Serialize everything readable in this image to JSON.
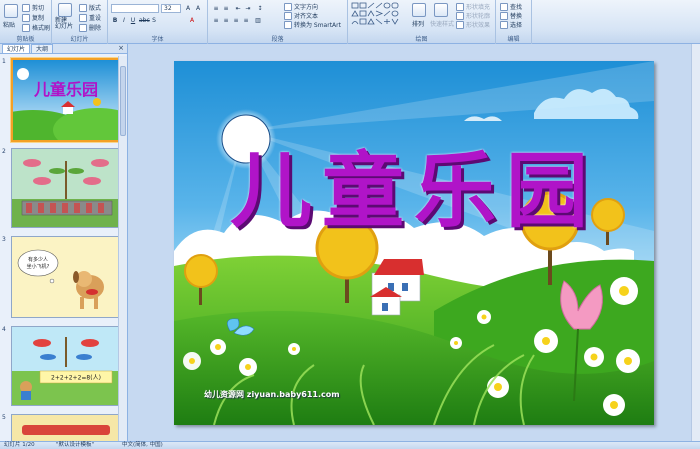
{
  "ribbon": {
    "clipboard": {
      "label": "剪贴板",
      "paste": "粘贴",
      "cut": "剪切",
      "copy": "复制",
      "format_painter": "格式刷"
    },
    "slides": {
      "label": "幻灯片",
      "new_slide": "新建\n幻灯片",
      "layout": "版式",
      "reset": "重设",
      "delete": "删除"
    },
    "font": {
      "label": "字体",
      "font_size": "32"
    },
    "paragraph": {
      "label": "段落",
      "text_direction": "文字方向",
      "align_text": "对齐文本",
      "smartart": "转换为 SmartArt"
    },
    "drawing": {
      "label": "绘图",
      "arrange": "排列",
      "quick_styles": "快速样式",
      "shape_fill": "形状填充",
      "shape_outline": "形状轮廓",
      "shape_effects": "形状效果"
    },
    "editing": {
      "label": "编辑",
      "find": "查找",
      "replace": "替换",
      "select": "选择"
    }
  },
  "panel": {
    "tab_slides": "幻灯片",
    "tab_outline": "大纲",
    "close": "×",
    "thumbnails": [
      {
        "num": "1",
        "title": "儿童乐园"
      },
      {
        "num": "2"
      },
      {
        "num": "3",
        "bubble": "有多少人\n坐小飞机?"
      },
      {
        "num": "4",
        "equation": "2+2+2+2=8(人)"
      },
      {
        "num": "5"
      }
    ]
  },
  "slide": {
    "title": "儿童乐园",
    "watermark": "幼儿资源网 ziyuan.baby611.com"
  },
  "status": {
    "slide_pos": "幻灯片 1/20",
    "theme": "\"默认设计模板\"",
    "language": "中文(简体, 中国)"
  },
  "colors": {
    "accent": "#f4a026",
    "title": "#b014c8",
    "ribbon": "#d6e4f5"
  }
}
